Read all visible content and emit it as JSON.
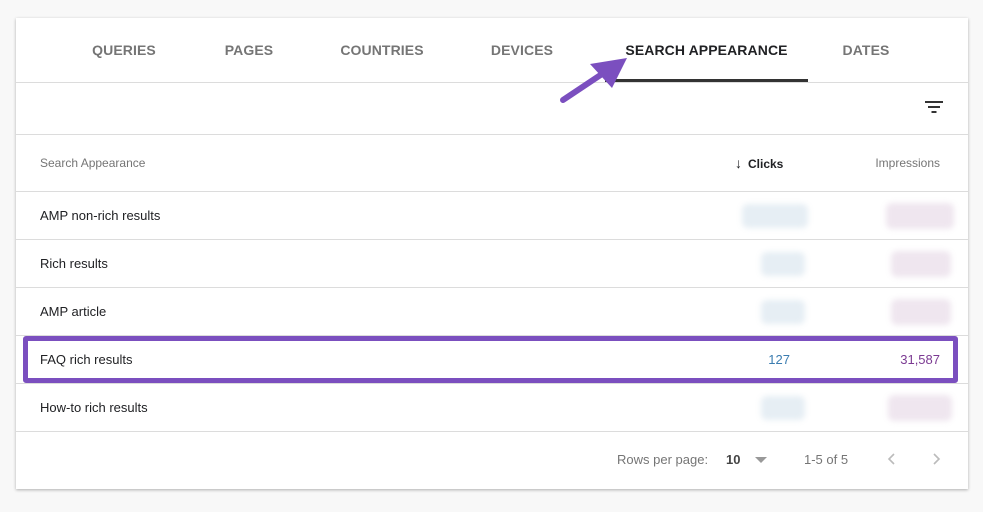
{
  "tabs": [
    {
      "label": "QUERIES",
      "active": false
    },
    {
      "label": "PAGES",
      "active": false
    },
    {
      "label": "COUNTRIES",
      "active": false
    },
    {
      "label": "DEVICES",
      "active": false
    },
    {
      "label": "SEARCH APPEARANCE",
      "active": true
    },
    {
      "label": "DATES",
      "active": false
    }
  ],
  "toolbar": {
    "filter_icon": "filter-icon"
  },
  "table": {
    "headers": {
      "name": "Search Appearance",
      "clicks": "Clicks",
      "impressions": "Impressions",
      "sort_icon": "arrow-down-icon"
    },
    "rows": [
      {
        "name": "AMP non-rich results",
        "clicks": "",
        "impressions": "",
        "blurred": true
      },
      {
        "name": "Rich results",
        "clicks": "",
        "impressions": "",
        "blurred": true
      },
      {
        "name": "AMP article",
        "clicks": "",
        "impressions": "",
        "blurred": true
      },
      {
        "name": "FAQ rich results",
        "clicks": "127",
        "impressions": "31,587",
        "blurred": false,
        "highlighted": true
      },
      {
        "name": "How-to rich results",
        "clicks": "",
        "impressions": "",
        "blurred": true
      }
    ]
  },
  "footer": {
    "rows_per_page_label": "Rows per page:",
    "rows_per_page_value": "10",
    "range": "1-5 of 5",
    "prev_icon": "chevron-left-icon",
    "next_icon": "chevron-right-icon"
  },
  "colors": {
    "highlight": "#7b4fbf",
    "arrow": "#7b4fbf",
    "clicks": "#3a7cb0",
    "impressions": "#7b3a92"
  }
}
